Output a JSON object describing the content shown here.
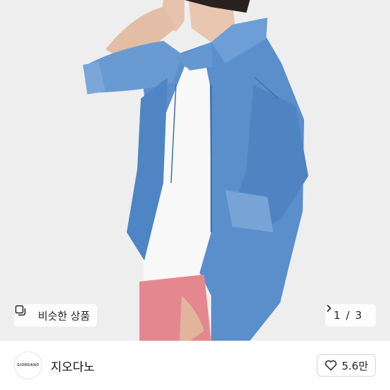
{
  "photo": {
    "description_icon": "product-photo"
  },
  "similar_button": {
    "label": "비슷한 상품",
    "icon": "similar-items-icon"
  },
  "pager": {
    "current": "1",
    "separator": "/",
    "total": "3",
    "next_icon": "chevron-right-icon"
  },
  "shop": {
    "logo_text": "GIORDANO",
    "name": "지오다노",
    "likes": "5.6만",
    "like_icon": "heart-icon"
  },
  "colors": {
    "denim": "#5b8fcb",
    "shorts": "#e5878f",
    "tshirt": "#fafafa"
  }
}
